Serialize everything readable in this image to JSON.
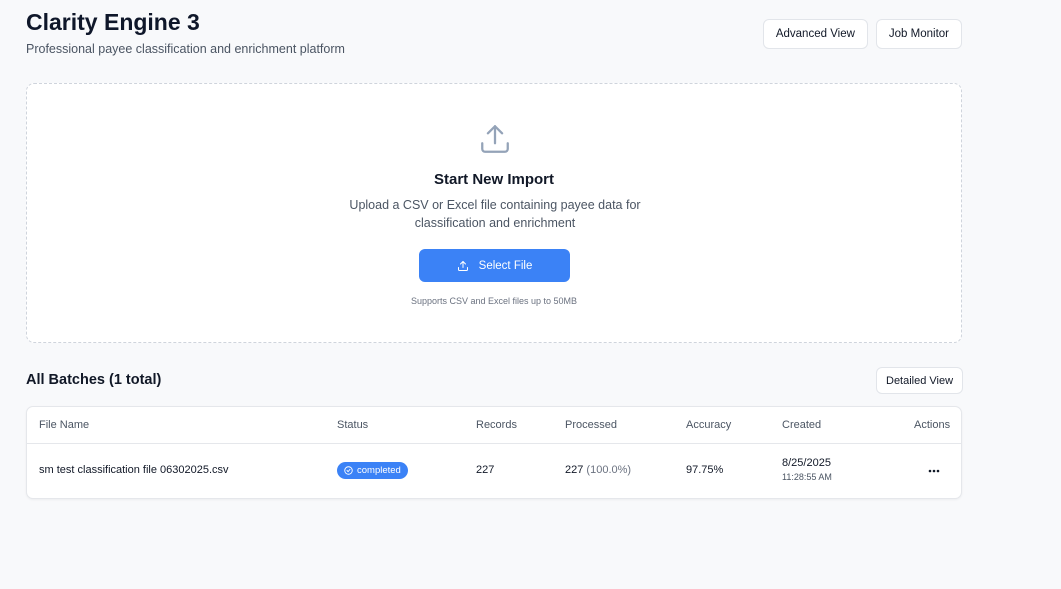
{
  "header": {
    "title": "Clarity Engine 3",
    "subtitle": "Professional payee classification and enrichment platform",
    "advanced_view_label": "Advanced View",
    "job_monitor_label": "Job Monitor"
  },
  "upload": {
    "icon": "upload-icon",
    "title": "Start New Import",
    "description": "Upload a CSV or Excel file containing payee data for classification and enrichment",
    "select_label": "Select File",
    "note": "Supports CSV and Excel files up to 50MB"
  },
  "batches": {
    "title": "All Batches (1 total)",
    "detailed_view_label": "Detailed View",
    "columns": [
      "File Name",
      "Status",
      "Records",
      "Processed",
      "Accuracy",
      "Created",
      "Actions"
    ],
    "rows": [
      {
        "file_name": "sm test classification file 06302025.csv",
        "status": "completed",
        "records": "227",
        "processed": "227",
        "processed_pct": "(100.0%)",
        "accuracy": "97.75%",
        "created_date": "8/25/2025",
        "created_time": "11:28:55 AM",
        "actions_icon": "more-horizontal-icon"
      }
    ]
  },
  "colors": {
    "accent": "#3b82f6",
    "background": "#f8f9fb",
    "border": "#e5e7eb"
  }
}
